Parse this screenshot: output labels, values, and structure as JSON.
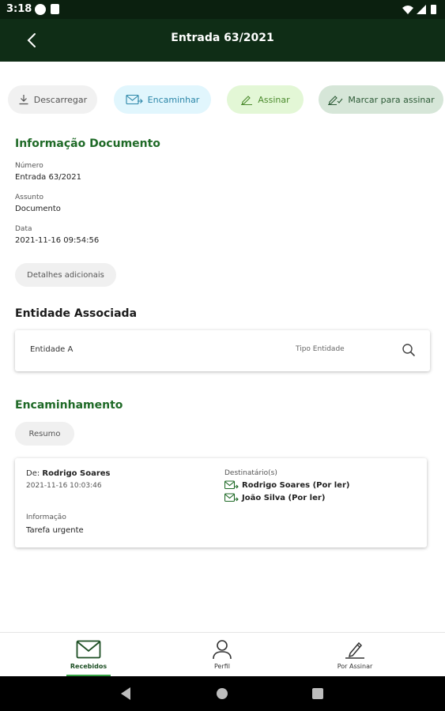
{
  "status_bar": {
    "time": "3:18"
  },
  "app_bar": {
    "title": "Entrada 63/2021"
  },
  "actions": {
    "descarregar": "Descarregar",
    "encaminhar": "Encaminhar",
    "assinar": "Assinar",
    "marcar": "Marcar para assinar"
  },
  "document_info": {
    "section_title": "Informação Documento",
    "numero_label": "Número",
    "numero_value": "Entrada 63/2021",
    "assunto_label": "Assunto",
    "assunto_value": "Documento",
    "data_label": "Data",
    "data_value": "2021-11-16 09:54:56",
    "details_button": "Detalhes adicionais"
  },
  "entity": {
    "section_title": "Entidade Associada",
    "name": "Entidade A",
    "type_label": "Tipo Entidade"
  },
  "forwarding": {
    "section_title": "Encaminhamento",
    "summary_button": "Resumo",
    "from_label": "De:",
    "from_name": "Rodrigo Soares",
    "date": "2021-11-16 10:03:46",
    "recipients_label": "Destinatário(s)",
    "recipients": [
      {
        "text": "Rodrigo Soares (Por ler)"
      },
      {
        "text": "João Silva  (Por ler)"
      }
    ],
    "info_label": "Informação",
    "info_value": "Tarefa urgente"
  },
  "bottom_nav": {
    "items": [
      {
        "label": "Recebidos",
        "icon": "mail-icon",
        "active": true
      },
      {
        "label": "Perfil",
        "icon": "person-icon",
        "active": false
      },
      {
        "label": "Por Assinar",
        "icon": "sign-pen-icon",
        "active": false
      }
    ]
  },
  "colors": {
    "app_bar": "#0f2d16",
    "section_green": "#1f6a27",
    "active_indicator": "#34a243"
  }
}
